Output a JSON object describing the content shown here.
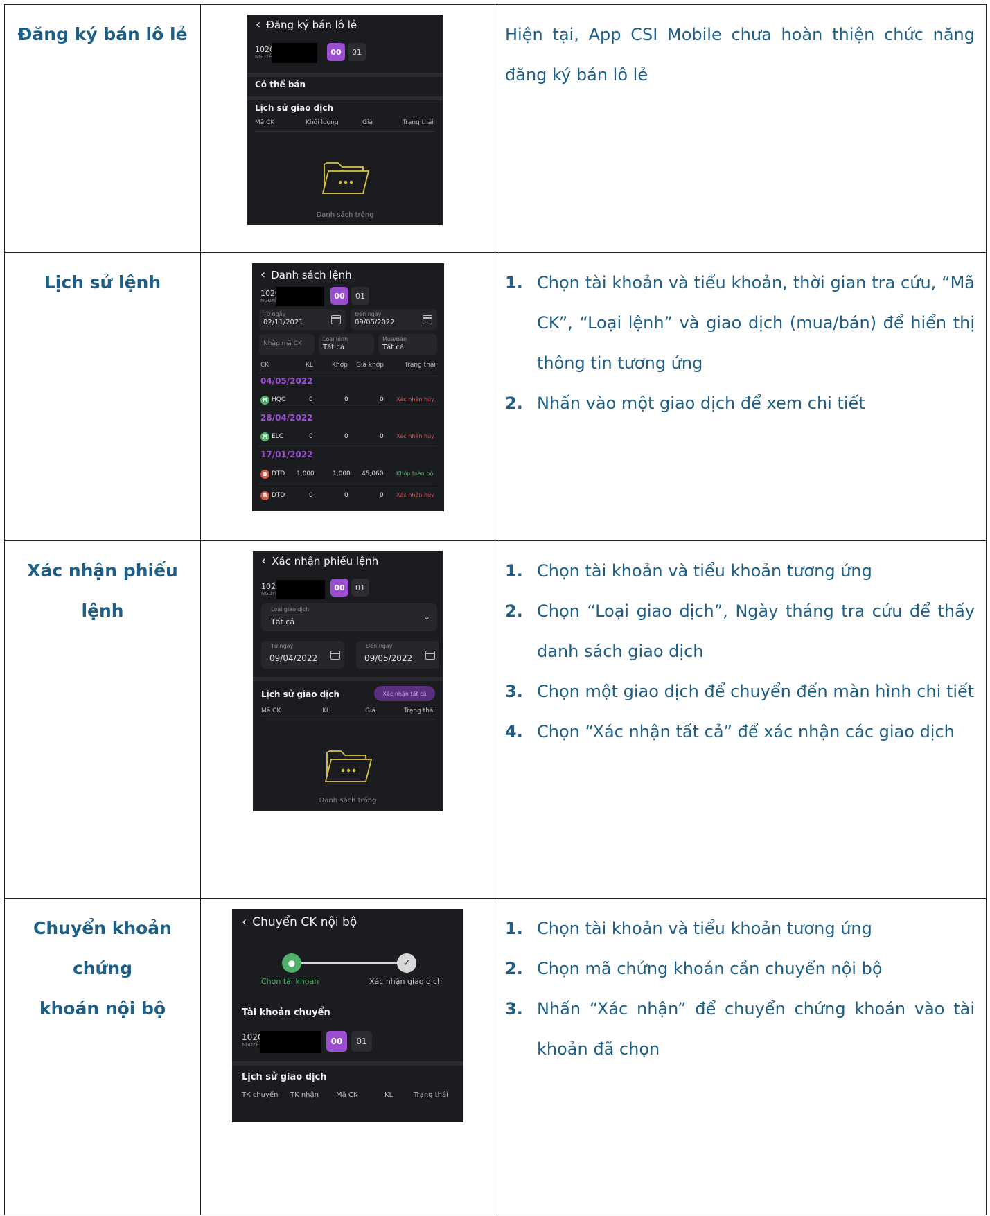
{
  "rows": [
    {
      "feature": [
        "Đăng ký bán lô lẻ"
      ],
      "desc_text": "Hiện tại, App CSI Mobile chưa hoàn thiện chức năng đăng ký bán lô lẻ",
      "screen": {
        "title": "Đăng ký bán lô lẻ",
        "account_id": "102C",
        "account_sub": "NGUYỄ",
        "chip_on": "00",
        "chip_off": "01",
        "section1": "Có thể bán",
        "section2": "Lịch sử giao dịch",
        "headers": [
          "Mã CK",
          "Khối lượng",
          "Giá",
          "Trạng thái"
        ],
        "empty": "Danh sách trống"
      }
    },
    {
      "feature": [
        "Lịch sử lệnh"
      ],
      "steps": [
        {
          "num": "1.",
          "text": "Chọn tài khoản và tiểu khoản, thời gian tra cứu, “Mã CK”, “Loại lệnh” và giao dịch (mua/bán) để hiển thị thông tin tương ứng"
        },
        {
          "num": "2.",
          "text": "Nhấn vào một giao dịch để xem chi tiết"
        }
      ],
      "screen": {
        "title": "Danh sách lệnh",
        "account_id": "102C",
        "account_sub": "NGUYỄ",
        "chip_on": "00",
        "chip_off": "01",
        "from_label": "Từ ngày",
        "from_value": "02/11/2021",
        "to_label": "Đến ngày",
        "to_value": "09/05/2022",
        "code_placeholder": "Nhập mã CK",
        "type_label": "Loại lệnh",
        "type_value": "Tất cả",
        "side_label": "Mua/Bán",
        "side_value": "Tất cả",
        "headers": [
          "CK",
          "KL",
          "Khớp",
          "Giá khớp",
          "Trạng thái"
        ],
        "groups": [
          {
            "date": "04/05/2022",
            "rows": [
              {
                "badge": "M",
                "code": "HQC",
                "kl": "0",
                "khop": "0",
                "gia": "0",
                "status": "Xác nhận hủy"
              }
            ]
          },
          {
            "date": "28/04/2022",
            "rows": [
              {
                "badge": "M",
                "code": "ELC",
                "kl": "0",
                "khop": "0",
                "gia": "0",
                "status": "Xác nhận hủy"
              }
            ]
          },
          {
            "date": "17/01/2022",
            "rows": [
              {
                "badge": "B",
                "code": "DTD",
                "kl": "1,000",
                "khop": "1,000",
                "gia": "45,060",
                "status": "Khớp toàn bộ"
              },
              {
                "badge": "B",
                "code": "DTD",
                "kl": "0",
                "khop": "0",
                "gia": "0",
                "status": "Xác nhận hủy"
              }
            ]
          }
        ]
      }
    },
    {
      "feature": [
        "Xác nhận phiếu lệnh"
      ],
      "steps": [
        {
          "num": "1.",
          "text": "Chọn tài khoản và tiểu khoản tương ứng"
        },
        {
          "num": "2.",
          "text": "Chọn “Loại giao dịch”, Ngày tháng tra cứu để thấy danh sách giao dịch"
        },
        {
          "num": "3.",
          "text": "Chọn một giao dịch để chuyển đến màn hình chi tiết"
        },
        {
          "num": "4.",
          "text": "Chọn “Xác nhận tất cả” để xác nhận các giao dịch"
        }
      ],
      "screen": {
        "title": "Xác nhận phiếu lệnh",
        "account_id": "102C",
        "account_sub": "NGUYỄ",
        "chip_on": "00",
        "chip_off": "01",
        "type_label": "Loại giao dịch",
        "type_value": "Tất cả",
        "from_label": "Từ ngày",
        "from_value": "09/04/2022",
        "to_label": "Đến ngày",
        "to_value": "09/05/2022",
        "section": "Lịch sử giao dịch",
        "confirm_all": "Xác nhận tất cả",
        "headers": [
          "Mã CK",
          "KL",
          "Giá",
          "Trạng thái"
        ],
        "empty": "Danh sách trống"
      }
    },
    {
      "feature": [
        "Chuyển khoản chứng",
        "khoán nội bộ"
      ],
      "steps": [
        {
          "num": "1.",
          "text": "Chọn tài khoản và tiểu khoản tương ứng"
        },
        {
          "num": "2.",
          "text": "Chọn mã chứng khoán cần chuyển nội bộ"
        },
        {
          "num": "3.",
          "text": "Nhấn “Xác nhận” để chuyển chứng khoán vào tài khoản đã chọn"
        }
      ],
      "screen": {
        "title": "Chuyển CK nội bộ",
        "step1": "Chọn tài khoản",
        "step2": "Xác nhận giao dịch",
        "section1": "Tài khoản chuyển",
        "account_id": "102C",
        "account_sub": "NGUYỄ",
        "chip_on": "00",
        "chip_off": "01",
        "section2": "Lịch sử giao dịch",
        "headers": [
          "TK chuyển",
          "TK nhận",
          "Mã CK",
          "KL",
          "Trạng thái"
        ]
      }
    }
  ],
  "colors": {
    "accent": "#1d5f86",
    "purple": "#9b4fd0",
    "screen_bg": "#1b1c1f"
  }
}
